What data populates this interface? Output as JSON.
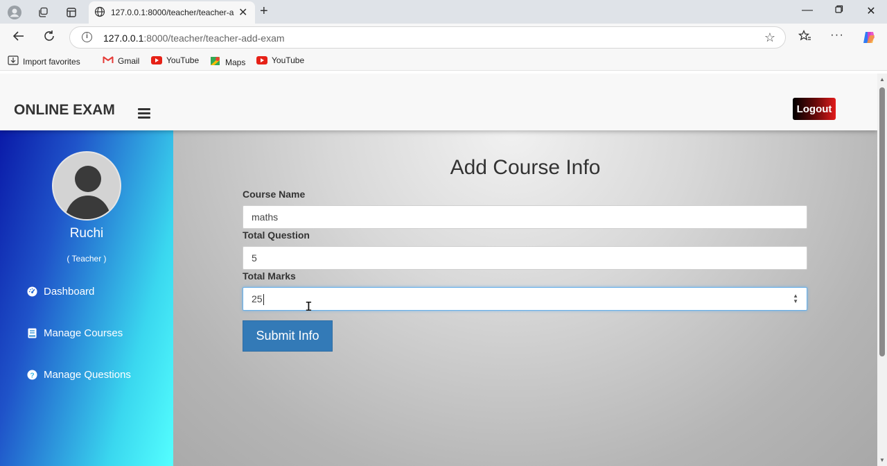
{
  "browser": {
    "tab_title": "127.0.0.1:8000/teacher/teacher-add-exam",
    "url_host": "127.0.0.1",
    "url_rest": ":8000/teacher/teacher-add-exam",
    "info_glyph": "i"
  },
  "bookmarks": [
    {
      "label": "Import favorites",
      "icon": "import-icon"
    },
    {
      "label": "Gmail",
      "icon": "gmail-icon"
    },
    {
      "label": "YouTube",
      "icon": "youtube-icon"
    },
    {
      "label": "Maps",
      "icon": "maps-icon"
    },
    {
      "label": "YouTube",
      "icon": "youtube-icon"
    }
  ],
  "navbar": {
    "brand": "ONLINE EXAM",
    "logout_label": "Logout"
  },
  "sidebar": {
    "user_name": "Ruchi",
    "user_role": "( Teacher )",
    "items": [
      {
        "label": "Dashboard",
        "icon": "dashboard-icon"
      },
      {
        "label": "Manage Courses",
        "icon": "book-icon"
      },
      {
        "label": "Manage Questions",
        "icon": "question-icon"
      }
    ]
  },
  "form": {
    "title": "Add Course Info",
    "course_name_label": "Course Name",
    "course_name_value": "maths",
    "total_question_label": "Total Question",
    "total_question_value": "5",
    "total_marks_label": "Total Marks",
    "total_marks_value": "25",
    "submit_label": "Submit Info"
  },
  "colors": {
    "submit": "#337ab7",
    "sidebar_start": "#0a1aa8",
    "sidebar_end": "#54ffff"
  }
}
